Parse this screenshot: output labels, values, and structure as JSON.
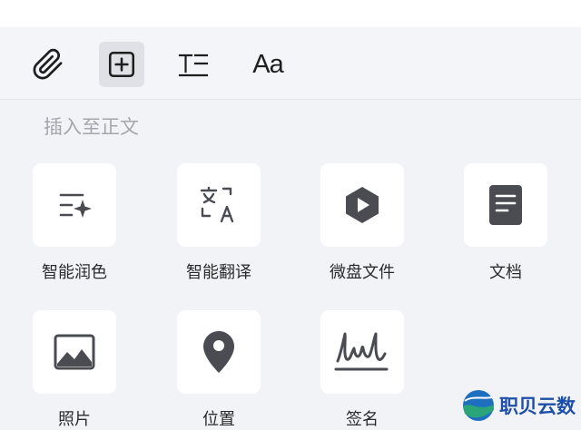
{
  "toolbar": {
    "items": [
      {
        "name": "attachment",
        "icon": "paperclip-icon",
        "active": false
      },
      {
        "name": "insert",
        "icon": "plus-square-icon",
        "active": true
      },
      {
        "name": "text-format",
        "icon": "text-format-icon",
        "active": false
      },
      {
        "name": "font",
        "icon": "font-icon",
        "label": "Aa",
        "active": false
      }
    ]
  },
  "section": {
    "title": "插入至正文"
  },
  "grid": {
    "items": [
      {
        "label": "智能润色",
        "icon": "sparkle-text-icon"
      },
      {
        "label": "智能翻译",
        "icon": "translate-icon"
      },
      {
        "label": "微盘文件",
        "icon": "cloud-drive-icon"
      },
      {
        "label": "文档",
        "icon": "document-icon"
      },
      {
        "label": "照片",
        "icon": "photo-icon"
      },
      {
        "label": "位置",
        "icon": "location-pin-icon"
      },
      {
        "label": "签名",
        "icon": "signature-icon"
      }
    ]
  },
  "watermark": {
    "text": "职贝云数",
    "icon": "globe-logo-icon"
  },
  "colors": {
    "background": "#f2f3f7",
    "tile": "#ffffff",
    "icon": "#4a4c52",
    "hint_text": "#a3a6ad",
    "active_tool": "#dfe1e6",
    "watermark": "#1e4fa8"
  }
}
